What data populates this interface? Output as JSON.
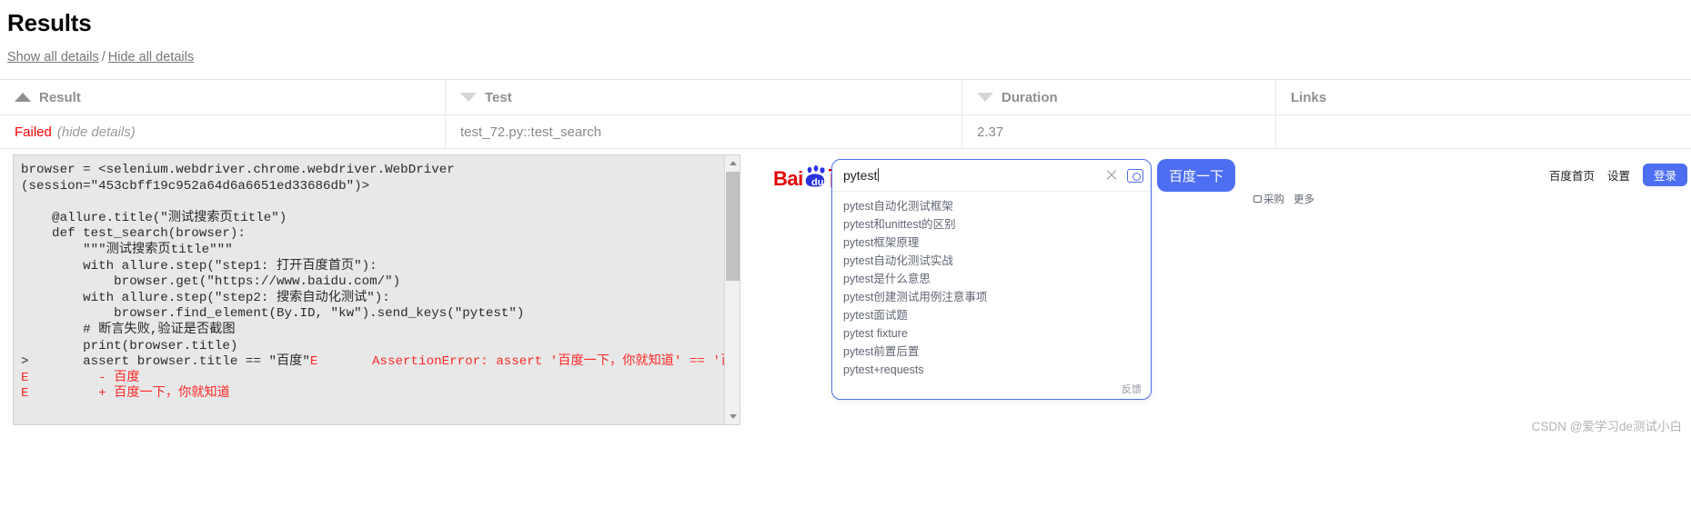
{
  "header": {
    "title": "Results",
    "show_all": "Show all details",
    "separator": "/",
    "hide_all": "Hide all details"
  },
  "table": {
    "columns": [
      {
        "label": "Result",
        "sort": "asc",
        "sort_icon": "triangle-up-icon"
      },
      {
        "label": "Test",
        "sort": "none",
        "sort_icon": "triangle-down-icon"
      },
      {
        "label": "Duration",
        "sort": "none",
        "sort_icon": "triangle-down-icon"
      },
      {
        "label": "Links",
        "sort": "none",
        "sort_icon": ""
      }
    ],
    "rows": [
      {
        "status": "Failed",
        "status_color": "#ff0000",
        "toggle": "(hide details)",
        "test": "test_72.py::test_search",
        "duration": "2.37",
        "links": ""
      }
    ]
  },
  "detail": {
    "code": "browser = <selenium.webdriver.chrome.webdriver.WebDriver\n(session=\"453cbff19c952a64d6a6651ed33686db\")>\n\n    @allure.title(\"测试搜索页title\")\n    def test_search(browser):\n        \"\"\"测试搜索页title\"\"\"\n        with allure.step(\"step1: 打开百度首页\"):\n            browser.get(\"https://www.baidu.com/\")\n        with allure.step(\"step2: 搜索自动化测试\"):\n            browser.find_element(By.ID, \"kw\").send_keys(\"pytest\")\n        # 断言失败,验证是否截图\n        print(browser.title)\n>       assert browser.title == \"百度\"",
    "error_lines": [
      "E       AssertionError: assert '百度一下，你就知道' == '百度'",
      "E         - 百度",
      "E         + 百度一下，你就知道"
    ],
    "scrollbar": {
      "up_icon": "triangle-up-icon",
      "down_icon": "triangle-down-icon"
    }
  },
  "baidu": {
    "logo_alt": "baidu-logo",
    "search": {
      "value": "pytest",
      "clear_icon": "close-icon",
      "camera_icon": "camera-icon",
      "submit_label": "百度一下"
    },
    "suggestions": [
      "pytest自动化测试框架",
      "pytest和unittest的区别",
      "pytest框架原理",
      "pytest自动化测试实战",
      "pytest是什么意思",
      "pytest创建测试用例注意事项",
      "pytest面试题",
      "pytest fixture",
      "pytest前置后置",
      "pytest+requests"
    ],
    "feedback_label": "反馈",
    "top_nav": [
      {
        "label": "百度首页",
        "type": "link"
      },
      {
        "label": "设置",
        "type": "link"
      },
      {
        "label": "登录",
        "type": "button"
      }
    ],
    "sub_nav": {
      "camera_label": "采购",
      "more_label": "更多"
    }
  },
  "watermark": "CSDN @爱学习de测试小白"
}
